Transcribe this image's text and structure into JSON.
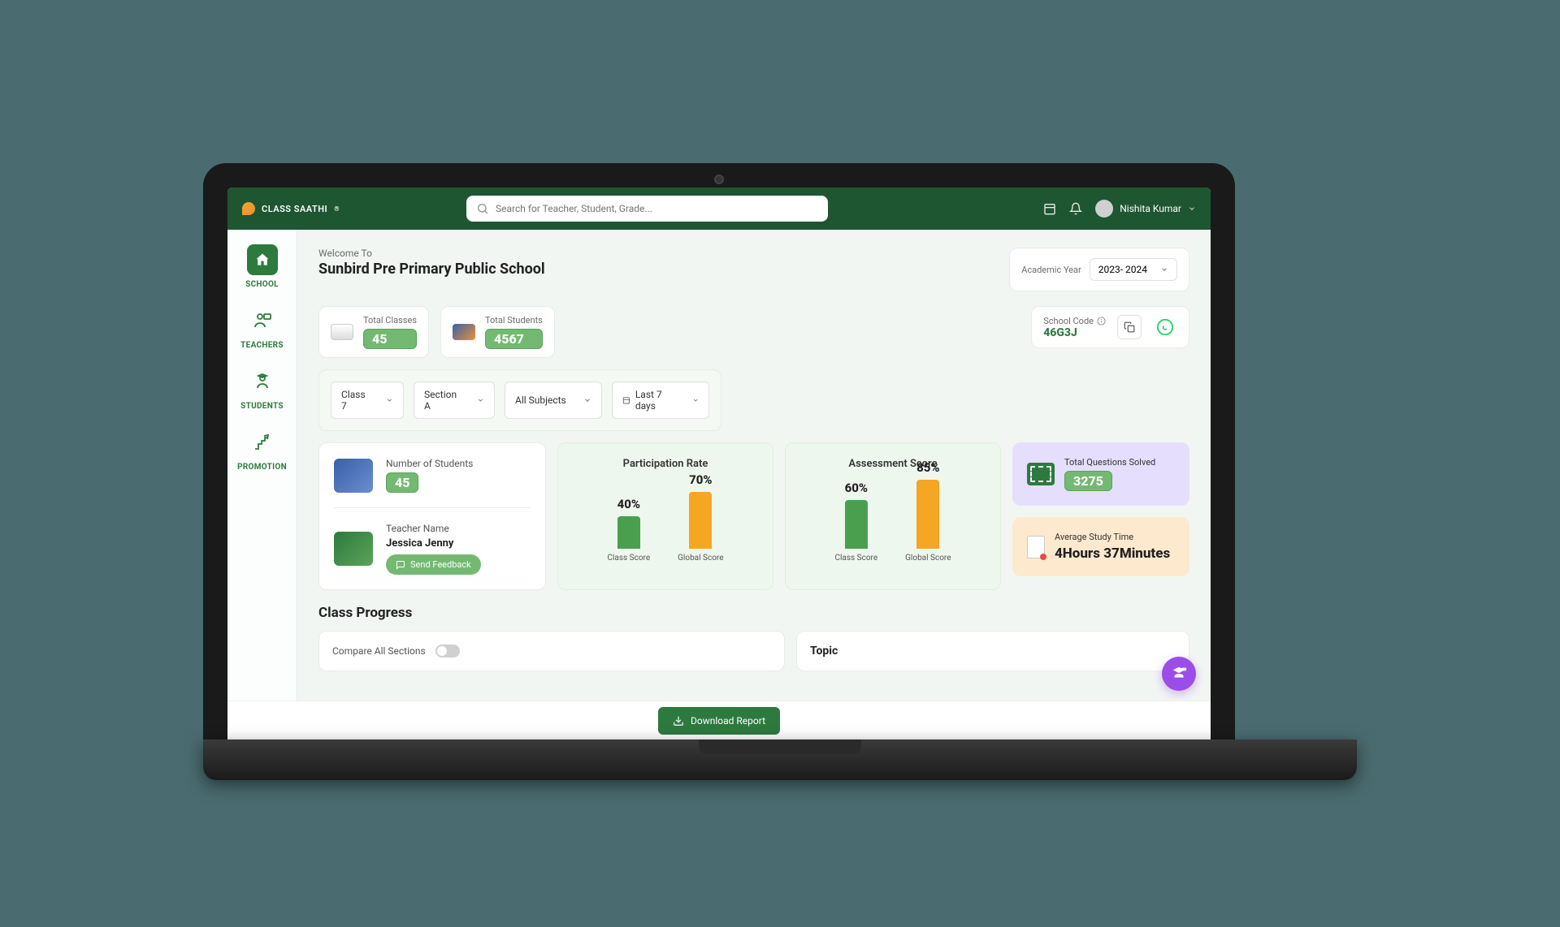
{
  "brand": "CLASS SAATHI",
  "search": {
    "placeholder": "Search for Teacher, Student, Grade..."
  },
  "user": {
    "name": "Nishita Kumar"
  },
  "sidebar": {
    "items": [
      {
        "label": "SCHOOL"
      },
      {
        "label": "TEACHERS"
      },
      {
        "label": "STUDENTS"
      },
      {
        "label": "PROMOTION"
      }
    ]
  },
  "header": {
    "welcome": "Welcome  To",
    "school_name": "Sunbird Pre Primary Public School",
    "academic_year_label": "Academic Year",
    "academic_year_value": "2023- 2024"
  },
  "stats": {
    "total_classes_label": "Total Classes",
    "total_classes_value": "45",
    "total_students_label": "Total Students",
    "total_students_value": "4567",
    "school_code_label": "School Code",
    "school_code_value": "46G3J"
  },
  "filters": {
    "class": "Class 7",
    "section": "Section A",
    "subject": "All Subjects",
    "range": "Last 7 days"
  },
  "class_info": {
    "num_students_label": "Number of Students",
    "num_students_value": "45",
    "teacher_label": "Teacher Name",
    "teacher_name": "Jessica Jenny",
    "feedback_btn": "Send Feedback"
  },
  "participation": {
    "title": "Participation Rate",
    "class_pct": "40%",
    "global_pct": "70%",
    "class_lbl": "Class Score",
    "global_lbl": "Global Score"
  },
  "assessment": {
    "title": "Assessment Score",
    "class_pct": "60%",
    "global_pct": "85%",
    "class_lbl": "Class Score",
    "global_lbl": "Global Score"
  },
  "questions": {
    "label": "Total Questions Solved",
    "value": "3275"
  },
  "study_time": {
    "label": "Average Study Time",
    "value": "4Hours 37Minutes"
  },
  "progress": {
    "title": "Class Progress",
    "compare_label": "Compare All Sections",
    "topic_label": "Topic"
  },
  "download_btn": "Download Report",
  "chart_data": [
    {
      "type": "bar",
      "title": "Participation Rate",
      "categories": [
        "Class Score",
        "Global Score"
      ],
      "values": [
        40,
        70
      ],
      "ylim": [
        0,
        100
      ],
      "ylabel": "Percent"
    },
    {
      "type": "bar",
      "title": "Assessment Score",
      "categories": [
        "Class Score",
        "Global Score"
      ],
      "values": [
        60,
        85
      ],
      "ylim": [
        0,
        100
      ],
      "ylabel": "Percent"
    }
  ]
}
